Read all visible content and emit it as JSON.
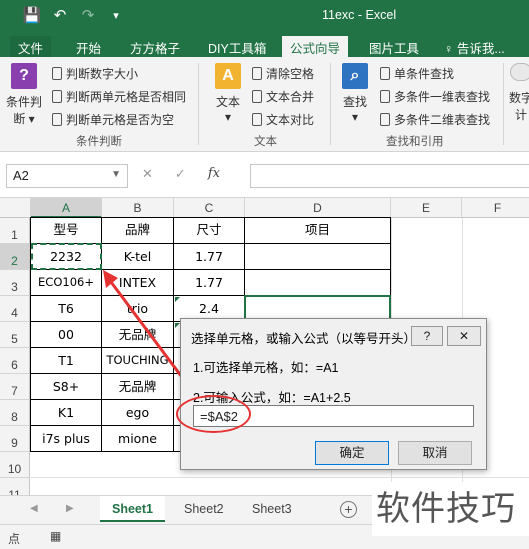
{
  "window": {
    "title": "11exc - Excel"
  },
  "quick_access": {
    "save_icon": "💾",
    "undo_icon": "↶",
    "redo_icon": "↷",
    "customize_icon": "▾"
  },
  "tabs": [
    {
      "label": "文件"
    },
    {
      "label": "开始"
    },
    {
      "label": "方方格子"
    },
    {
      "label": "DIY工具箱"
    },
    {
      "label": "公式向导"
    },
    {
      "label": "图片工具"
    },
    {
      "label": "♀ 告诉我..."
    }
  ],
  "ribbon": {
    "groups": {
      "condition": {
        "big_label_1": "条件判",
        "big_label_2": "断 ▾",
        "items": [
          "判断数字大小",
          "判断两单元格是否相同",
          "判断单元格是否为空"
        ],
        "label": "条件判断"
      },
      "text": {
        "big_label_1": "文本",
        "big_label_2": "▾",
        "items": [
          "清除空格",
          "文本合并",
          "文本对比"
        ],
        "label": "文本"
      },
      "lookup": {
        "big_label_1": "查找",
        "big_label_2": "▾",
        "items": [
          "单条件查找",
          "多条件一维表查找",
          "多条件二维表查找"
        ],
        "label": "查找和引用"
      },
      "number": {
        "big_label_1": "数字",
        "big_label_2": "计"
      }
    }
  },
  "formula_bar": {
    "name_box": "A2",
    "cancel_icon": "✕",
    "enter_icon": "✓",
    "fx_icon": "fx",
    "formula": ""
  },
  "columns": [
    "A",
    "B",
    "C",
    "D",
    "E",
    "F"
  ],
  "rows": [
    "1",
    "2",
    "3",
    "4",
    "5",
    "6",
    "7",
    "8",
    "9",
    "10",
    "11"
  ],
  "table": {
    "headers": [
      "型号",
      "品牌",
      "尺寸",
      "项目"
    ],
    "data": [
      [
        "2232",
        "K-tel",
        "1.77",
        ""
      ],
      [
        "ECO106+",
        "INTEX",
        "1.77",
        ""
      ],
      [
        "T6",
        "trio",
        "2.4",
        ""
      ],
      [
        "00",
        "无品牌",
        "",
        ""
      ],
      [
        "T1",
        "TOUCHING",
        "",
        ""
      ],
      [
        "S8+",
        "无品牌",
        "",
        ""
      ],
      [
        "K1",
        "ego",
        "",
        ""
      ],
      [
        "i7s plus",
        "mione",
        "",
        ""
      ]
    ]
  },
  "sheets": [
    {
      "label": "Sheet1"
    },
    {
      "label": "Sheet2"
    },
    {
      "label": "Sheet3"
    }
  ],
  "sheet_nav": {
    "prev": "◀",
    "next": "▶",
    "add": "+"
  },
  "status": {
    "mode": "点",
    "icon": "▦"
  },
  "dialog": {
    "title": "选择单元格，或输入公式（以等号开头）",
    "help_label": "?",
    "close_label": "✕",
    "line1": "1.可选择单元格，如：=A1",
    "line2": "2.可输入公式，如：=A1+2.5",
    "input_value": "=$A$2",
    "ok_label": "确定",
    "cancel_label": "取消"
  },
  "watermark": "软件技巧",
  "colors": {
    "excel_green": "#217346",
    "annotation_red": "#e53232"
  }
}
